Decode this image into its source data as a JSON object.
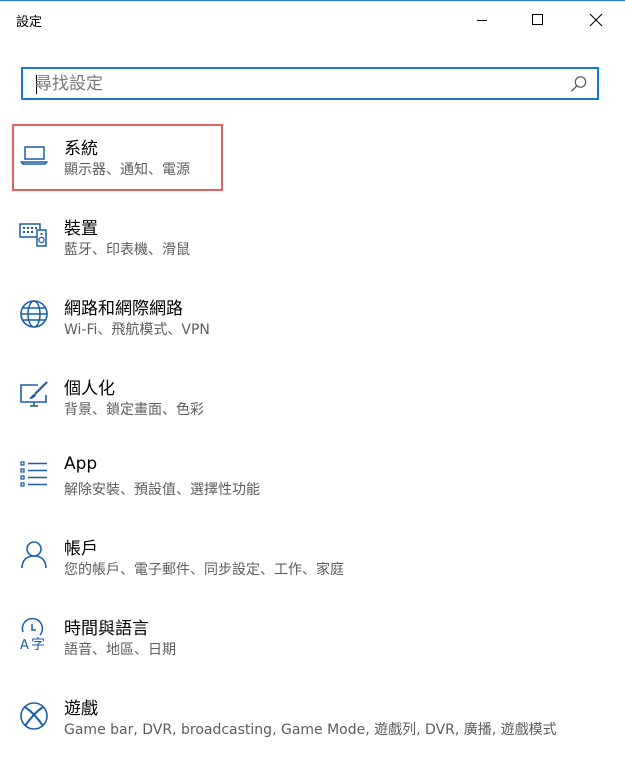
{
  "window": {
    "title": "設定"
  },
  "search": {
    "placeholder": "尋找設定",
    "value": ""
  },
  "items": [
    {
      "label": "系統",
      "desc": "顯示器、通知、電源",
      "icon": "laptop-icon"
    },
    {
      "label": "裝置",
      "desc": "藍牙、印表機、滑鼠",
      "icon": "devices-icon"
    },
    {
      "label": "網路和網際網路",
      "desc": "Wi-Fi、飛航模式、VPN",
      "icon": "globe-icon"
    },
    {
      "label": "個人化",
      "desc": "背景、鎖定畫面、色彩",
      "icon": "personalization-icon"
    },
    {
      "label": "App",
      "desc": "解除安裝、預設值、選擇性功能",
      "icon": "apps-list-icon"
    },
    {
      "label": "帳戶",
      "desc": "您的帳戶、電子郵件、同步設定、工作、家庭",
      "icon": "person-icon"
    },
    {
      "label": "時間與語言",
      "desc": "語音、地區、日期",
      "icon": "time-language-icon"
    },
    {
      "label": "遊戲",
      "desc": "Game bar, DVR, broadcasting, Game Mode, 遊戲列, DVR, 廣播, 遊戲模式",
      "icon": "xbox-icon"
    }
  ],
  "colors": {
    "accent": "#1976d2",
    "selection_border": "#e06262",
    "icon": "#1c5fa8"
  }
}
